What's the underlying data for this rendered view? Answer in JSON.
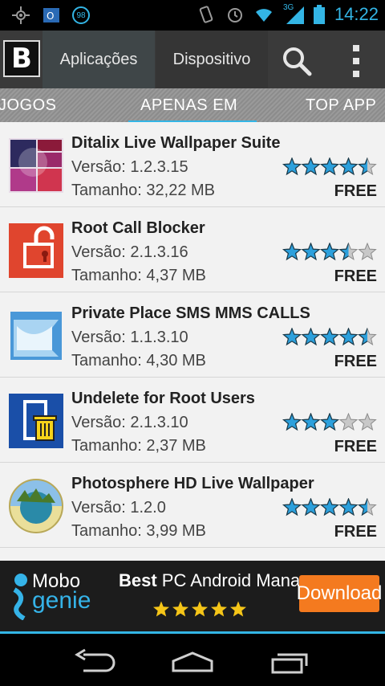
{
  "status_bar": {
    "time": "14:22",
    "badge": "98",
    "network": "3G",
    "icons": [
      "gps-icon",
      "outlook-icon",
      "badge-icon",
      "vibrate-icon",
      "alarm-icon",
      "wifi-icon",
      "signal-icon",
      "battery-icon"
    ],
    "accent": "#33b5e5"
  },
  "app_bar": {
    "logo": "B",
    "tabs": [
      "Aplicações",
      "Dispositivo"
    ],
    "icons": [
      "search-icon",
      "overflow-menu-icon"
    ]
  },
  "tab_strip": {
    "items": [
      "JOGOS",
      "APENAS EM",
      "TOP APP"
    ],
    "active": "APENAS EM"
  },
  "apps": [
    {
      "title": "Ditalix Live Wallpaper Suite",
      "version": "Versão: 1.2.3.15",
      "size": "Tamanho: 32,22 MB",
      "rating": 4.5,
      "price": "FREE"
    },
    {
      "title": "Root Call Blocker",
      "version": "Versão: 2.1.3.16",
      "size": "Tamanho: 4,37 MB",
      "rating": 3.5,
      "price": "FREE"
    },
    {
      "title": "Private Place SMS MMS CALLS",
      "version": "Versão: 1.1.3.10",
      "size": "Tamanho: 4,30 MB",
      "rating": 4.5,
      "price": "FREE"
    },
    {
      "title": "Undelete for Root Users",
      "version": "Versão: 2.1.3.10",
      "size": "Tamanho: 2,37 MB",
      "rating": 3,
      "price": "FREE"
    },
    {
      "title": "Photosphere HD Live Wallpaper",
      "version": "Versão: 1.2.0",
      "size": "Tamanho: 3,99 MB",
      "rating": 4.5,
      "price": "FREE"
    }
  ],
  "ad": {
    "brand_top": "Mobo",
    "brand_bottom": "genie",
    "headline_bold": "Best",
    "headline_rest": " PC Android Manager",
    "stars": 5,
    "button": "Download",
    "button_color": "#f47a1f"
  },
  "nav": {
    "icons": [
      "back-icon",
      "home-icon",
      "recent-apps-icon"
    ]
  }
}
